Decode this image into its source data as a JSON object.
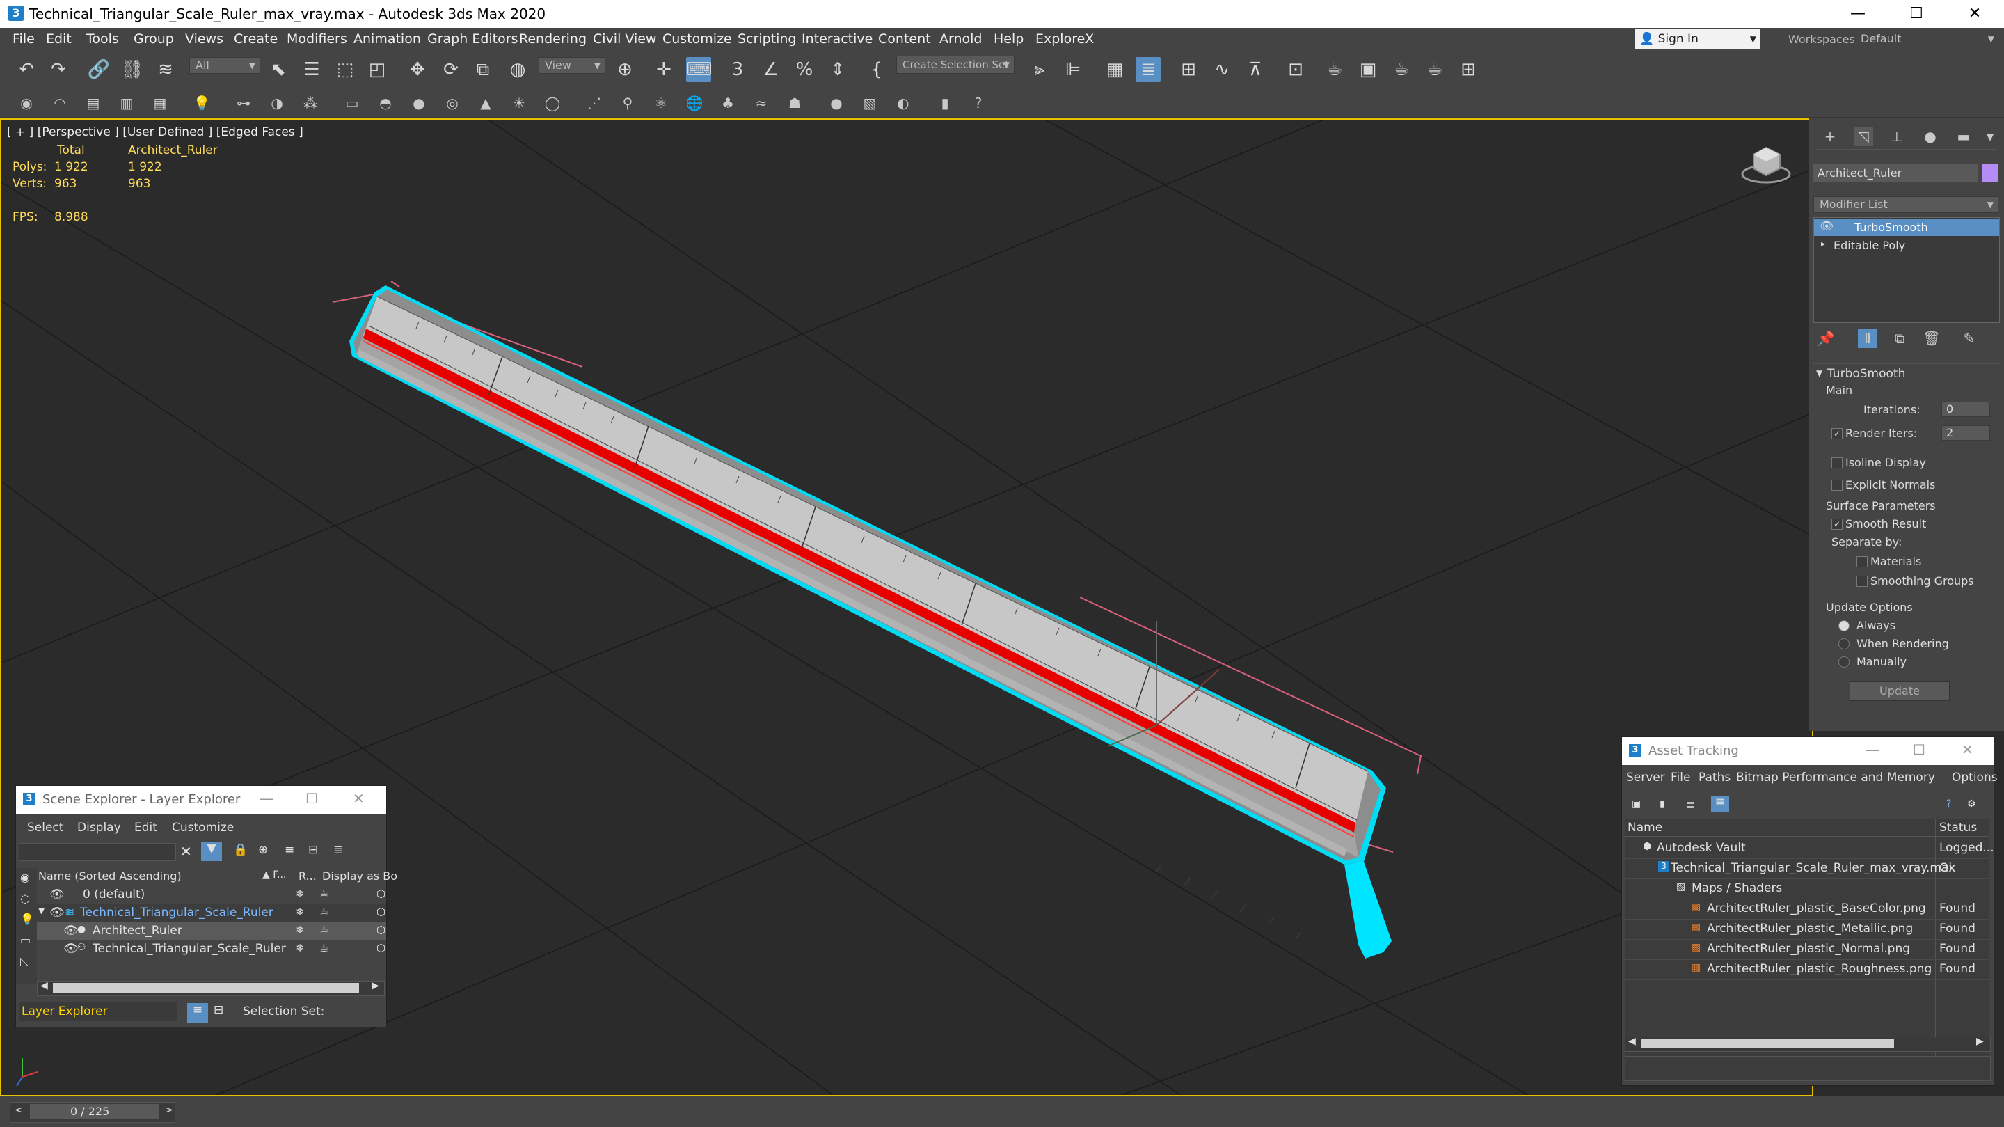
{
  "window": {
    "title": "Technical_Triangular_Scale_Ruler_max_vray.max - Autodesk 3ds Max 2020",
    "app_icon": "3",
    "minimize": "—",
    "maximize": "☐",
    "close": "✕"
  },
  "menu": [
    "File",
    "Edit",
    "Tools",
    "Group",
    "Views",
    "Create",
    "Modifiers",
    "Animation",
    "Graph Editors",
    "Rendering",
    "Civil View",
    "Customize",
    "Scripting",
    "Interactive",
    "Content",
    "Arnold",
    "Help",
    "ExploreX"
  ],
  "account": {
    "sign_in": "Sign In",
    "workspaces_label": "Workspaces:",
    "workspace": "Default"
  },
  "toolbar": {
    "filter": "All",
    "ref_coord": "View",
    "selection_set": "Create Selection Set"
  },
  "viewport": {
    "label": "[ + ] [Perspective ] [User Defined ] [Edged Faces ]",
    "stats": {
      "col_total": "Total",
      "col_object": "Architect_Ruler",
      "polys_label": "Polys:",
      "polys_total": "1 922",
      "polys_obj": "1 922",
      "verts_label": "Verts:",
      "verts_total": "963",
      "verts_obj": "963",
      "fps_label": "FPS:",
      "fps_value": "8.988"
    }
  },
  "command_panel": {
    "object_name": "Architect_Ruler",
    "object_color": "#b58cf5",
    "modifier_list": "Modifier List",
    "stack": [
      "TurboSmooth",
      "Editable Poly"
    ],
    "rollout_title": "TurboSmooth",
    "main_label": "Main",
    "iterations_label": "Iterations:",
    "iterations_value": "0",
    "render_iters_label": "Render Iters:",
    "render_iters_value": "2",
    "isoline": "Isoline Display",
    "explicit_normals": "Explicit Normals",
    "surface_params": "Surface Parameters",
    "smooth_result": "Smooth Result",
    "separate_by": "Separate by:",
    "materials": "Materials",
    "smoothing_groups": "Smoothing Groups",
    "update_options": "Update Options",
    "always": "Always",
    "when_rendering": "When Rendering",
    "manually": "Manually",
    "update_button": "Update"
  },
  "scene_explorer": {
    "title": "Scene Explorer - Layer Explorer",
    "menu": [
      "Select",
      "Display",
      "Edit",
      "Customize"
    ],
    "columns": {
      "name": "Name (Sorted Ascending)",
      "f": "▲ F...",
      "r": "R...",
      "display": "Display as Bo"
    },
    "rows": [
      {
        "name": "0 (default)"
      },
      {
        "name": "Technical_Triangular_Scale_Ruler"
      },
      {
        "name": "Architect_Ruler"
      },
      {
        "name": "Technical_Triangular_Scale_Ruler"
      }
    ],
    "footer_layer": "Layer Explorer",
    "footer_selection": "Selection Set:"
  },
  "asset_tracking": {
    "title": "Asset Tracking",
    "menu": [
      "Server",
      "File",
      "Paths",
      "Bitmap Performance and Memory",
      "Options"
    ],
    "col_name": "Name",
    "col_status": "Status",
    "rows": [
      {
        "name": "Autodesk Vault",
        "status": "Logged..."
      },
      {
        "name": "Technical_Triangular_Scale_Ruler_max_vray.max",
        "status": "Ok"
      },
      {
        "name": "Maps / Shaders",
        "status": ""
      },
      {
        "name": "ArchitectRuler_plastic_BaseColor.png",
        "status": "Found"
      },
      {
        "name": "ArchitectRuler_plastic_Metallic.png",
        "status": "Found"
      },
      {
        "name": "ArchitectRuler_plastic_Normal.png",
        "status": "Found"
      },
      {
        "name": "ArchitectRuler_plastic_Roughness.png",
        "status": "Found"
      }
    ]
  },
  "timeline": {
    "frame": "0 / 225"
  }
}
